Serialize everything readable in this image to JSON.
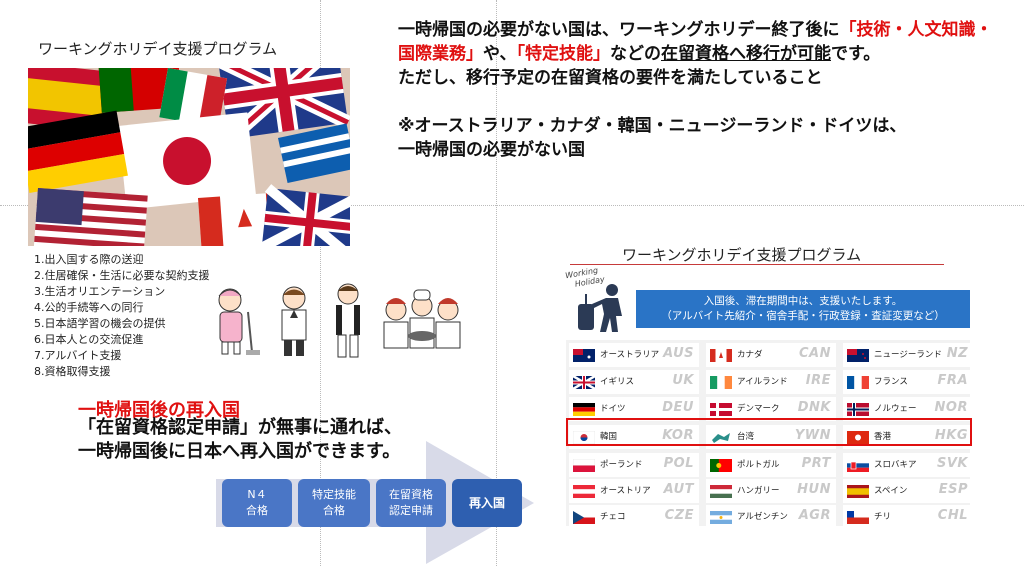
{
  "left_panel": {
    "title": "ワーキングホリデイ支援プログラム",
    "support_items": [
      "1.出入国する際の送迎",
      "2.住居確保・生活に必要な契約支援",
      "3.生活オリエンテーション",
      "4.公的手続等への同行",
      "5.日本語学習の機会の提供",
      "6.日本人との交流促進",
      "7.アルバイト支援",
      "8.資格取得支援"
    ]
  },
  "reentry": {
    "title": "一時帰国後の再入国",
    "line1": "「在留資格認定申請」が無事に通れば、",
    "line2": "一時帰国後に日本へ再入国ができます。",
    "steps": [
      {
        "line1": "N４",
        "line2": "合格"
      },
      {
        "line1": "特定技能",
        "line2": "合格"
      },
      {
        "line1": "在留資格",
        "line2": "認定申請"
      },
      {
        "line1": "再入国",
        "line2": ""
      }
    ]
  },
  "notice": {
    "p1_a": "一時帰国の必要がない国は、ワーキングホリデー終了後に",
    "p1_b": "「技術・人文知識・国際業務」",
    "p1_c": "や、",
    "p1_d": "「特定技能」",
    "p1_e": "などの",
    "p1_f": "在留資格へ移行が可能",
    "p1_g": "です。",
    "p2": "ただし、移行予定の在留資格の要件を満たしていること",
    "p3": "※オーストラリア・カナダ・韓国・ニュージーランド・ドイツは、",
    "p4": "一時帰国の必要がない国"
  },
  "right_panel": {
    "title": "ワーキングホリデイ支援プログラム",
    "logo_line1": "Working",
    "logo_line2": "Holiday",
    "banner_line1": "入国後、滞在期間中は、支援いたします。",
    "banner_line2": "（アルバイト先紹介・宿舎手配・行政登録・査証変更など）",
    "countries": [
      {
        "name": "オーストラリア",
        "code": "AUS",
        "flag": "au"
      },
      {
        "name": "カナダ",
        "code": "CAN",
        "flag": "ca"
      },
      {
        "name": "ニュージーランド",
        "code": "NZ",
        "flag": "nz"
      },
      {
        "name": "イギリス",
        "code": "UK",
        "flag": "uk"
      },
      {
        "name": "アイルランド",
        "code": "IRE",
        "flag": "ie"
      },
      {
        "name": "フランス",
        "code": "FRA",
        "flag": "fr"
      },
      {
        "name": "ドイツ",
        "code": "DEU",
        "flag": "de"
      },
      {
        "name": "デンマーク",
        "code": "DNK",
        "flag": "dk"
      },
      {
        "name": "ノルウェー",
        "code": "NOR",
        "flag": "no"
      },
      {
        "name": "韓国",
        "code": "KOR",
        "flag": "kr"
      },
      {
        "name": "台湾",
        "code": "YWN",
        "flag": "tw"
      },
      {
        "name": "香港",
        "code": "HKG",
        "flag": "hk"
      },
      {
        "name": "ポーランド",
        "code": "POL",
        "flag": "pl"
      },
      {
        "name": "ポルトガル",
        "code": "PRT",
        "flag": "pt"
      },
      {
        "name": "スロバキア",
        "code": "SVK",
        "flag": "sk"
      },
      {
        "name": "オーストリア",
        "code": "AUT",
        "flag": "at"
      },
      {
        "name": "ハンガリー",
        "code": "HUN",
        "flag": "hu"
      },
      {
        "name": "スペイン",
        "code": "ESP",
        "flag": "es"
      },
      {
        "name": "チェコ",
        "code": "CZE",
        "flag": "cz"
      },
      {
        "name": "アルゼンチン",
        "code": "AGR",
        "flag": "ar"
      },
      {
        "name": "チリ",
        "code": "CHL",
        "flag": "cl"
      }
    ]
  },
  "colors": {
    "accent_red": "#e01010",
    "banner_blue": "#2a74c6",
    "step_blue": "#4a76c6",
    "arrow_gray": "#d8dae8"
  }
}
